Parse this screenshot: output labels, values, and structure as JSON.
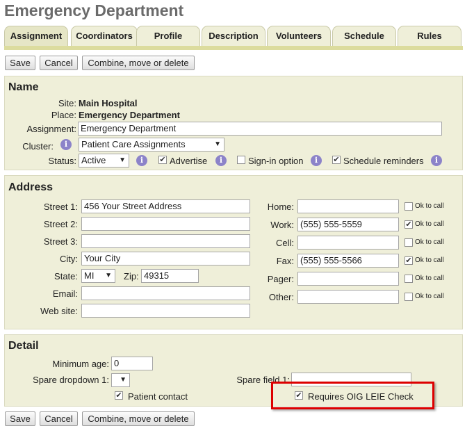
{
  "page_title": "Emergency Department",
  "tabs": [
    {
      "label": "Assignment"
    },
    {
      "label": "Coordinators"
    },
    {
      "label": "Profile"
    },
    {
      "label": "Description"
    },
    {
      "label": "Volunteers"
    },
    {
      "label": "Schedule"
    },
    {
      "label": "Rules"
    }
  ],
  "buttons": {
    "save": "Save",
    "cancel": "Cancel",
    "combine": "Combine, move or delete"
  },
  "name_section": {
    "heading": "Name",
    "site_label": "Site:",
    "site_value": "Main Hospital",
    "place_label": "Place:",
    "place_value": "Emergency Department",
    "assignment_label": "Assignment:",
    "assignment_value": "Emergency Department",
    "cluster_label": "Cluster:",
    "cluster_value": "Patient Care Assignments",
    "status_label": "Status:",
    "status_value": "Active",
    "advertise_label": "Advertise",
    "advertise_checked": true,
    "signin_label": "Sign-in option",
    "signin_checked": false,
    "reminders_label": "Schedule reminders",
    "reminders_checked": true
  },
  "address_section": {
    "heading": "Address",
    "street1_label": "Street 1:",
    "street1_value": "456 Your Street Address",
    "street2_label": "Street 2:",
    "street2_value": "",
    "street3_label": "Street 3:",
    "street3_value": "",
    "city_label": "City:",
    "city_value": "Your City",
    "state_label": "State:",
    "state_value": "MI",
    "zip_label": "Zip:",
    "zip_value": "49315",
    "email_label": "Email:",
    "email_value": "",
    "website_label": "Web site:",
    "website_value": "",
    "ok_to_call": "Ok to call",
    "phones": [
      {
        "label": "Home:",
        "value": "",
        "ok": false
      },
      {
        "label": "Work:",
        "value": "(555) 555-5559",
        "ok": true
      },
      {
        "label": "Cell:",
        "value": "",
        "ok": false
      },
      {
        "label": "Fax:",
        "value": "(555) 555-5566",
        "ok": true
      },
      {
        "label": "Pager:",
        "value": "",
        "ok": false
      },
      {
        "label": "Other:",
        "value": "",
        "ok": false
      }
    ]
  },
  "detail_section": {
    "heading": "Detail",
    "min_age_label": "Minimum age:",
    "min_age_value": "0",
    "spare_dropdown_label": "Spare dropdown 1:",
    "spare_dropdown_value": "",
    "spare_field_label": "Spare field 1:",
    "spare_field_value": "",
    "patient_contact_label": "Patient contact",
    "patient_contact_checked": true,
    "oig_label": "Requires OIG LEIE Check",
    "oig_checked": true
  },
  "colors": {
    "panel": "#efefd9",
    "tab_bar": "#dcdc9e",
    "info_icon": "#8c83c9",
    "highlight": "#dd0000"
  }
}
